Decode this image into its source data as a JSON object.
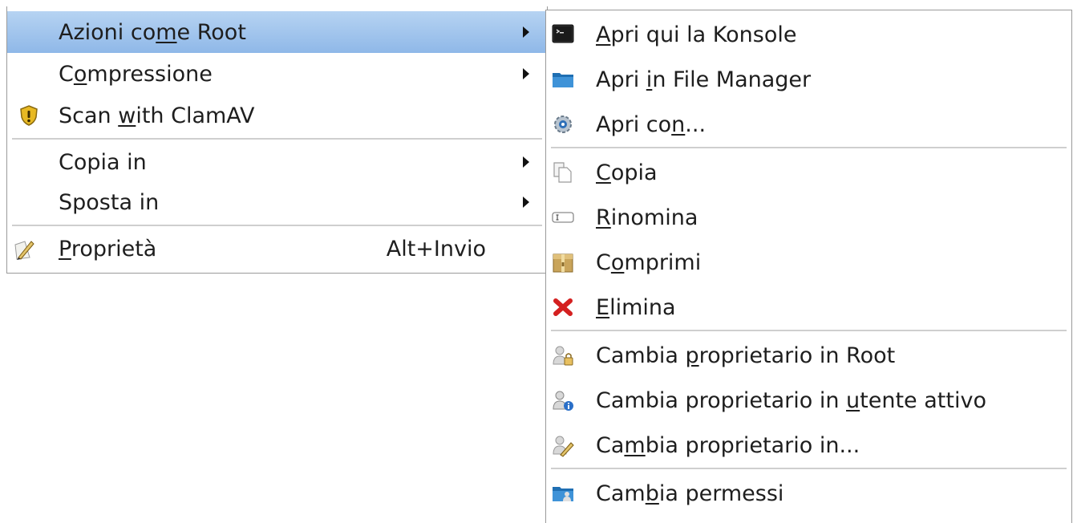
{
  "main_menu": {
    "items": [
      {
        "label_pre": "Azioni co",
        "label_acc": "m",
        "label_post": "e Root",
        "submenu": true,
        "highlighted": true
      },
      {
        "label_pre": "C",
        "label_acc": "o",
        "label_post": "mpressione",
        "submenu": true
      },
      {
        "label_pre": "Scan ",
        "label_acc": "w",
        "label_post": "ith ClamAV",
        "icon": "shield-warning-icon"
      },
      {
        "label": "Copia in",
        "submenu": true
      },
      {
        "label": "Sposta in",
        "submenu": true
      },
      {
        "label_pre": "",
        "label_acc": "P",
        "label_post": "roprietà",
        "shortcut": "Alt+Invio",
        "icon": "properties-pencil-icon"
      }
    ]
  },
  "sub_menu": {
    "items": [
      {
        "label_pre": "",
        "label_acc": "A",
        "label_post": "pri qui la Konsole",
        "icon": "terminal-icon"
      },
      {
        "label_pre": "Apri ",
        "label_acc": "i",
        "label_post": "n File Manager",
        "icon": "folder-icon"
      },
      {
        "label_pre": "Apri co",
        "label_acc": "n",
        "label_post": "...",
        "icon": "gear-icon"
      },
      {
        "label_pre": "",
        "label_acc": "C",
        "label_post": "opia",
        "icon": "copy-icon"
      },
      {
        "label_pre": "",
        "label_acc": "R",
        "label_post": "inomina",
        "icon": "rename-icon"
      },
      {
        "label_pre": "C",
        "label_acc": "o",
        "label_post": "mprimi",
        "icon": "archive-box-icon"
      },
      {
        "label_pre": "",
        "label_acc": "E",
        "label_post": "limina",
        "icon": "delete-x-icon"
      },
      {
        "label_pre": "Cambia ",
        "label_acc": "p",
        "label_post": "roprietario in Root",
        "icon": "user-lock-icon"
      },
      {
        "label_pre": "Cambia proprietario in ",
        "label_acc": "u",
        "label_post": "tente attivo",
        "icon": "user-info-icon"
      },
      {
        "label_pre": "Ca",
        "label_acc": "m",
        "label_post": "bia proprietario in...",
        "icon": "user-edit-icon"
      },
      {
        "label_pre": "Cam",
        "label_acc": "b",
        "label_post": "ia permessi",
        "icon": "permissions-folder-icon"
      }
    ]
  },
  "colors": {
    "highlight_top": "#b6d3f2",
    "highlight_bottom": "#8fb8e8",
    "separator": "#cfcfcf",
    "text": "#1e1e1e",
    "delete_red": "#d42020"
  }
}
